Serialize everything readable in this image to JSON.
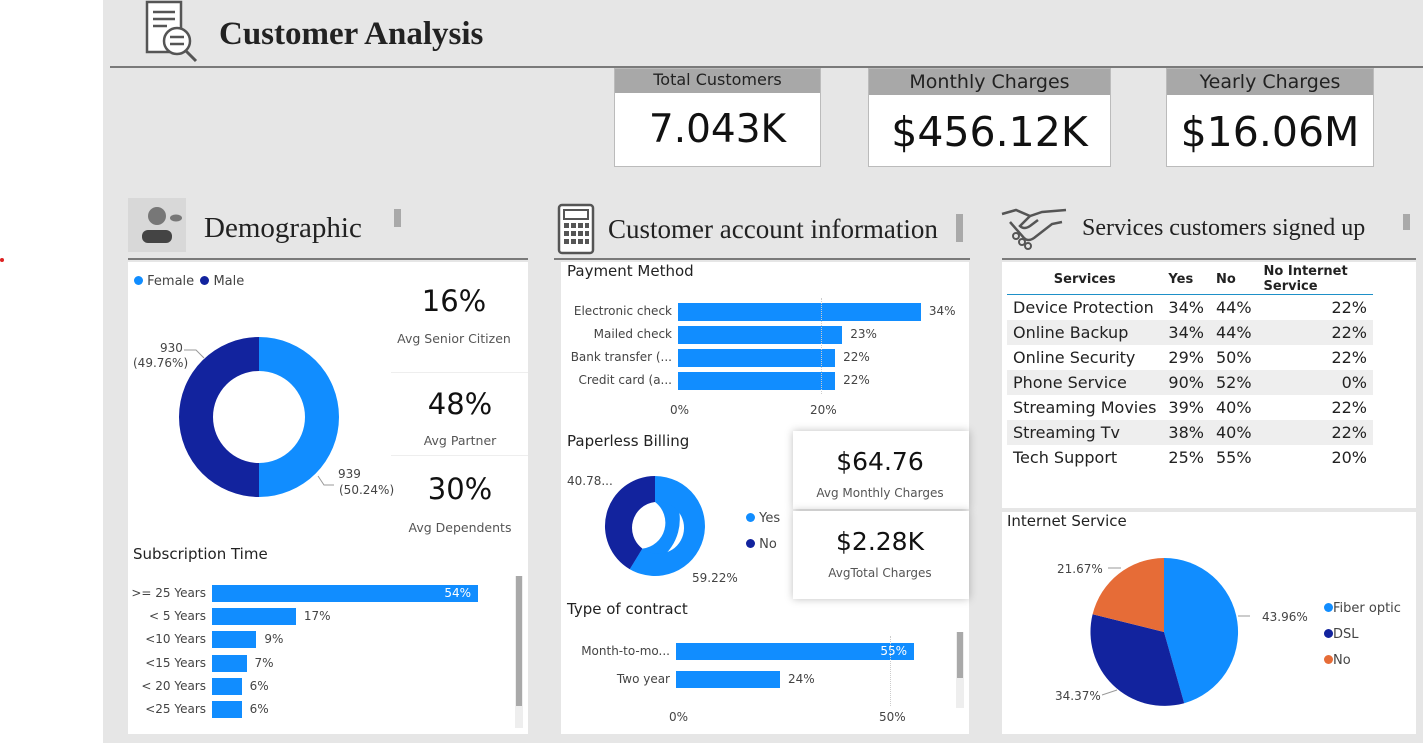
{
  "page": {
    "title": "Customer Analysis"
  },
  "kpis": [
    {
      "label": "Total Customers",
      "value": "7.043K"
    },
    {
      "label": "Monthly Charges",
      "value": "$456.12K"
    },
    {
      "label": "Yearly Charges",
      "value": "$16.06M"
    }
  ],
  "sections": {
    "demographic": "Demographic",
    "account": "Customer account information",
    "services": "Services customers signed up"
  },
  "demographic": {
    "legend": [
      "Female",
      "Male"
    ],
    "gender_labels": {
      "male_count": "930",
      "male_pct": "(49.76%)",
      "female_count": "939",
      "female_pct": "(50.24%)"
    },
    "stats": [
      {
        "value": "16%",
        "label": "Avg Senior Citizen"
      },
      {
        "value": "48%",
        "label": "Avg Partner"
      },
      {
        "value": "30%",
        "label": "Avg Dependents"
      }
    ],
    "subscription_title": "Subscription Time"
  },
  "account": {
    "payment_title": "Payment Method",
    "payment_axis": [
      "0%",
      "20%"
    ],
    "paperless_title": "Paperless Billing",
    "paperless_legend": [
      "Yes",
      "No"
    ],
    "paperless_labels": {
      "no": "40.78...",
      "yes": "59.22%"
    },
    "avg_monthly": {
      "value": "$64.76",
      "label": "Avg Monthly Charges"
    },
    "avg_total": {
      "value": "$2.28K",
      "label": "AvgTotal Charges"
    },
    "contract_title": "Type of contract",
    "contract_axis": [
      "0%",
      "50%"
    ]
  },
  "services_table": {
    "headers": [
      "Services",
      "Yes",
      "No",
      "No Internet Service"
    ],
    "rows": [
      [
        "Device Protection",
        "34%",
        "44%",
        "22%"
      ],
      [
        "Online Backup",
        "34%",
        "44%",
        "22%"
      ],
      [
        "Online Security",
        "29%",
        "50%",
        "22%"
      ],
      [
        "Phone Service",
        "90%",
        "52%",
        "0%"
      ],
      [
        "Streaming Movies",
        "39%",
        "40%",
        "22%"
      ],
      [
        "Streaming Tv",
        "38%",
        "40%",
        "22%"
      ],
      [
        "Tech Support",
        "25%",
        "55%",
        "20%"
      ]
    ]
  },
  "internet": {
    "title": "Internet Service",
    "legend": [
      "Fiber optic",
      "DSL",
      "No"
    ],
    "labels": {
      "no": "21.67%",
      "fiber": "43.96%",
      "dsl": "34.37%"
    }
  },
  "colors": {
    "light_blue": "#118dff",
    "dark_blue": "#12239e",
    "orange": "#e66c37"
  },
  "chart_data": [
    {
      "type": "pie",
      "title": "",
      "categories": [
        "Female",
        "Male"
      ],
      "values": [
        50.24,
        49.76
      ]
    },
    {
      "type": "bar",
      "title": "Subscription Time",
      "categories": [
        ">= 25 Years",
        "< 5 Years",
        "<10 Years",
        "<15 Years",
        "< 20 Years",
        "<25 Years"
      ],
      "values": [
        54,
        17,
        9,
        7,
        6,
        6
      ],
      "labels": [
        "54%",
        "17%",
        "9%",
        "7%",
        "6%",
        "6%"
      ],
      "xlim": [
        0,
        60
      ]
    },
    {
      "type": "bar",
      "title": "Payment Method",
      "categories": [
        "Electronic check",
        "Mailed check",
        "Bank transfer (...",
        "Credit card (a..."
      ],
      "values": [
        34,
        23,
        22,
        22
      ],
      "labels": [
        "34%",
        "23%",
        "22%",
        "22%"
      ],
      "xlim": [
        0,
        35
      ]
    },
    {
      "type": "pie",
      "title": "Paperless Billing",
      "categories": [
        "Yes",
        "No"
      ],
      "values": [
        59.22,
        40.78
      ]
    },
    {
      "type": "bar",
      "title": "Type of contract",
      "categories": [
        "Month-to-mo...",
        "Two year"
      ],
      "values": [
        55,
        24
      ],
      "labels": [
        "55%",
        "24%"
      ],
      "xlim": [
        0,
        60
      ]
    },
    {
      "type": "pie",
      "title": "Internet Service",
      "categories": [
        "Fiber optic",
        "DSL",
        "No"
      ],
      "values": [
        43.96,
        34.37,
        21.67
      ]
    }
  ]
}
